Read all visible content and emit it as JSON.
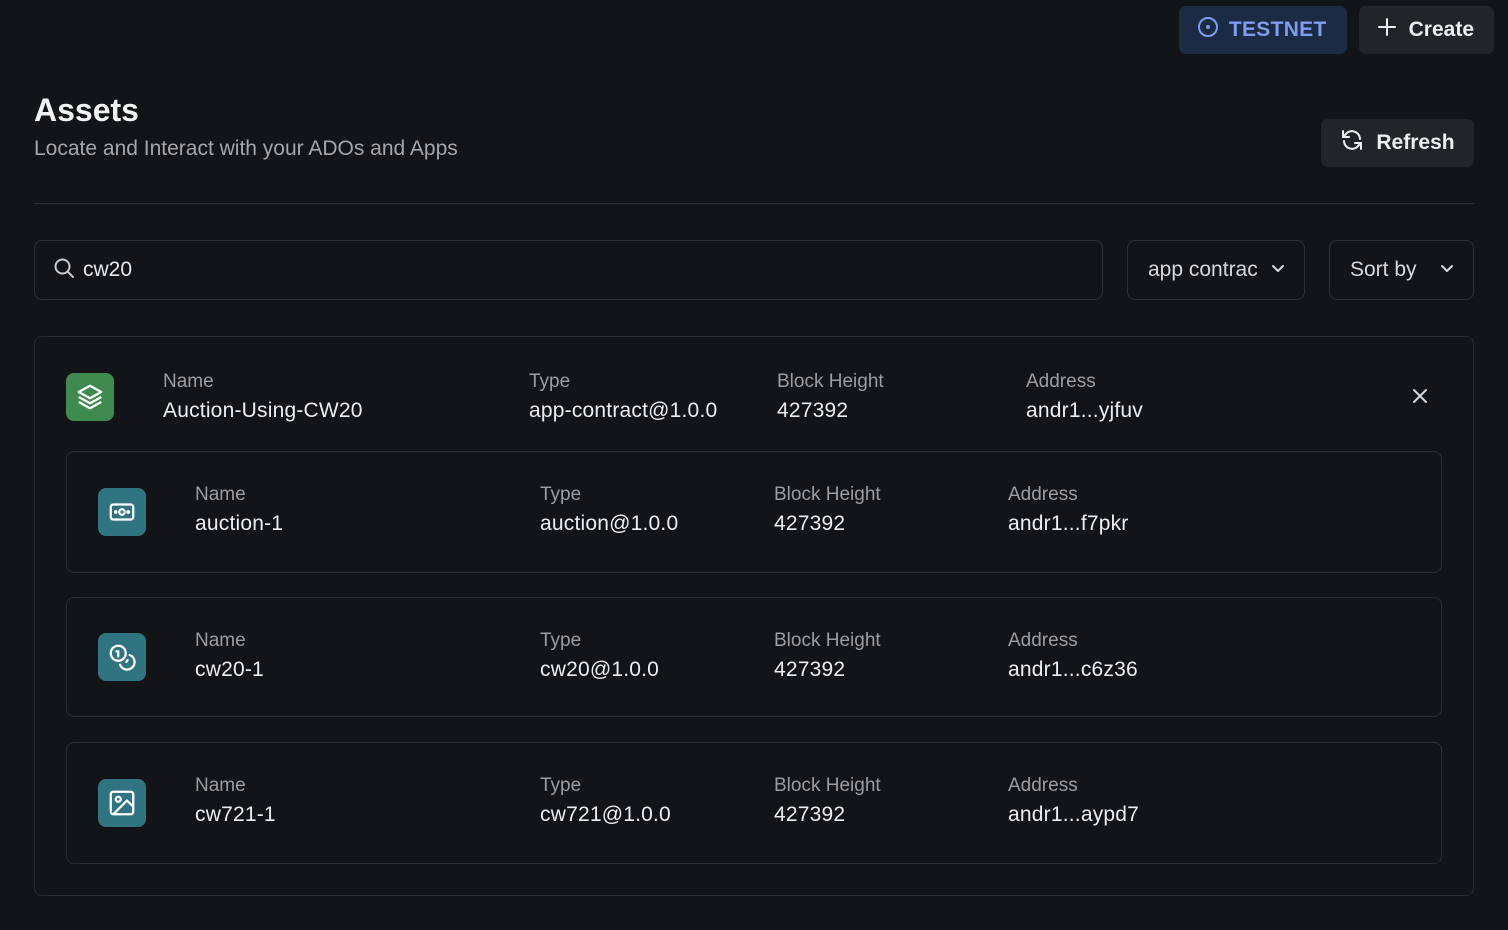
{
  "topbar": {
    "network_label": "TESTNET",
    "create_label": "Create"
  },
  "header": {
    "title": "Assets",
    "subtitle": "Locate and Interact with your ADOs and Apps",
    "refresh_label": "Refresh"
  },
  "filters": {
    "search_value": "cw20",
    "type_filter": "app contract",
    "sort_label": "Sort by"
  },
  "columns": {
    "name": "Name",
    "type": "Type",
    "block_height": "Block Height",
    "address": "Address"
  },
  "app": {
    "icon": "layers-icon",
    "name": "Auction-Using-CW20",
    "type": "app-contract@1.0.0",
    "block_height": "427392",
    "address": "andr1...yjfuv"
  },
  "components": [
    {
      "icon": "banknote-icon",
      "name": "auction-1",
      "type": "auction@1.0.0",
      "block_height": "427392",
      "address": "andr1...f7pkr"
    },
    {
      "icon": "coins-icon",
      "name": "cw20-1",
      "type": "cw20@1.0.0",
      "block_height": "427392",
      "address": "andr1...c6z36"
    },
    {
      "icon": "image-icon",
      "name": "cw721-1",
      "type": "cw721@1.0.0",
      "block_height": "427392",
      "address": "andr1...aypd7"
    }
  ],
  "colors": {
    "background": "#131418",
    "accent_network": "#7f9cf0",
    "app_icon_bg": "#3f8a4f",
    "ado_icon_bg": "#2f7480"
  }
}
